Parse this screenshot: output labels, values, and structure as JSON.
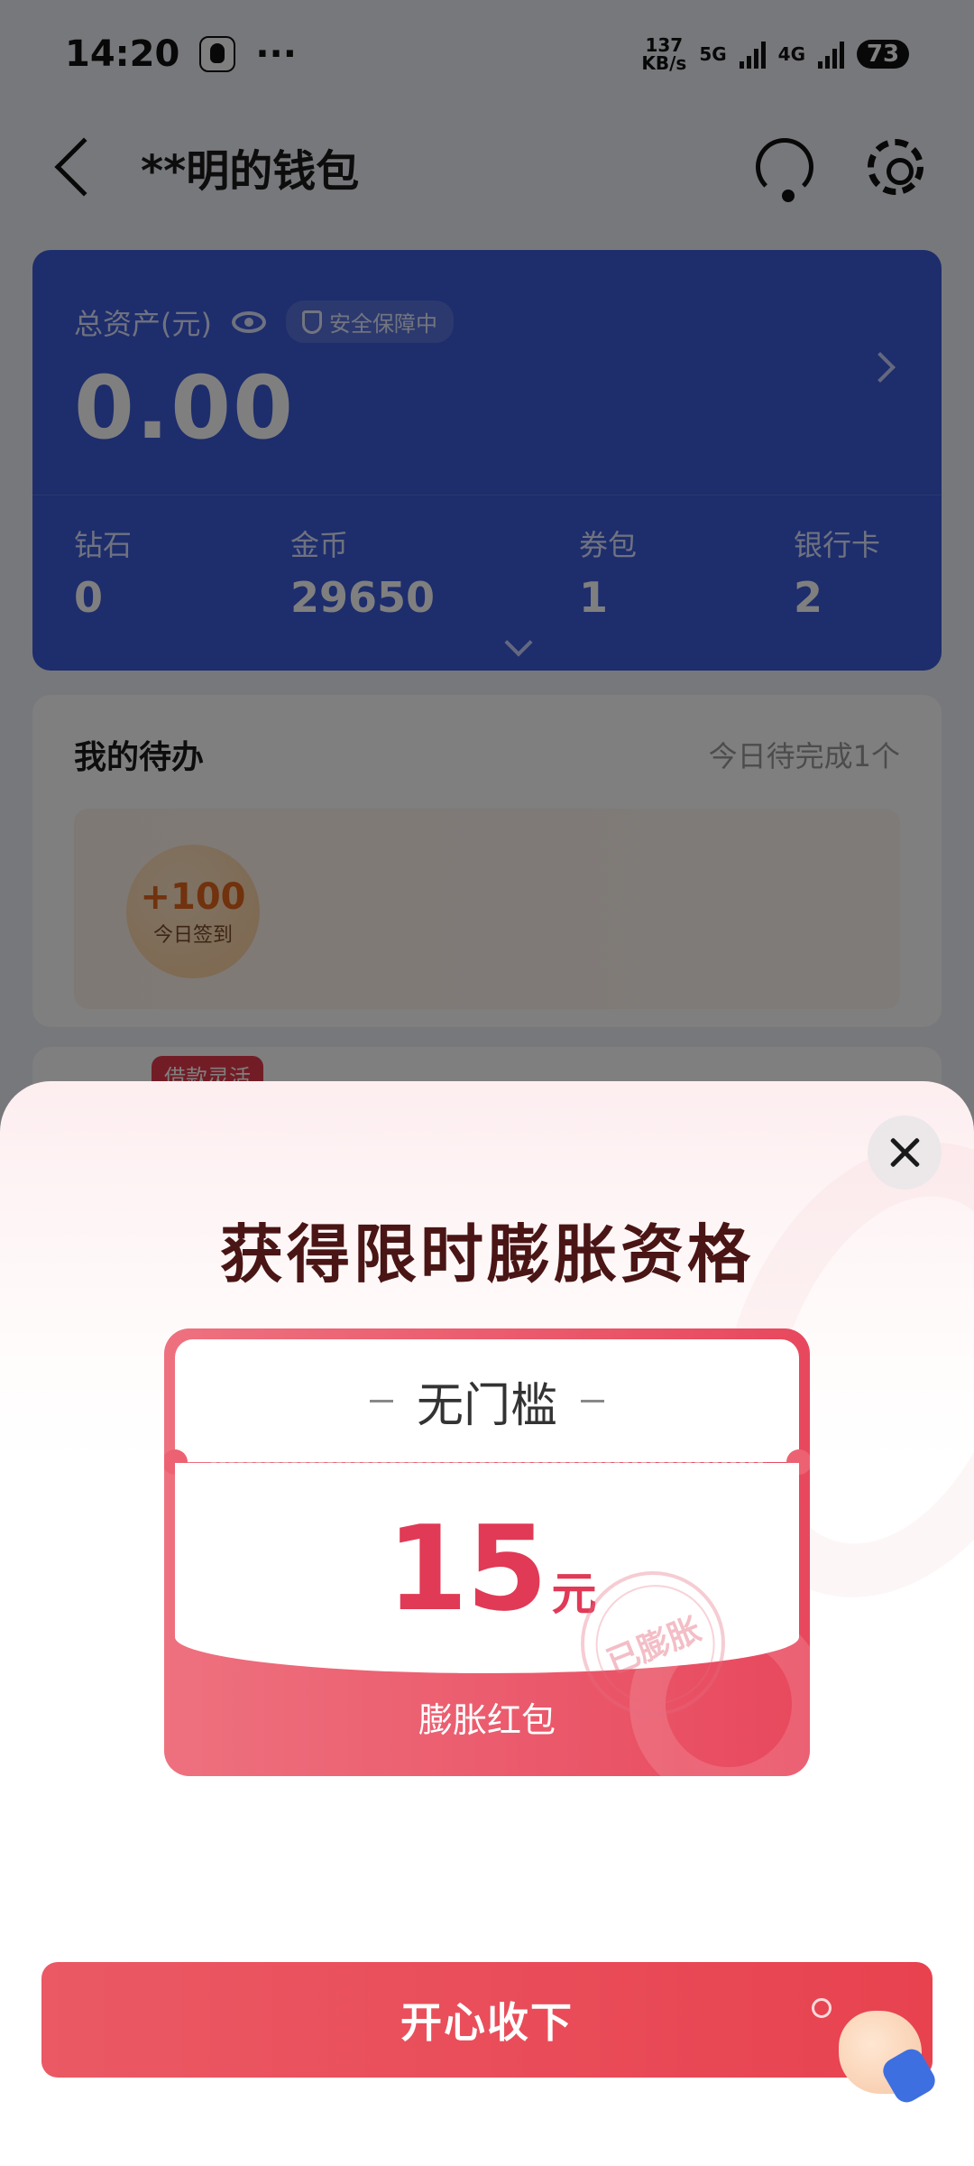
{
  "status_bar": {
    "time": "14:20",
    "more": "···",
    "net_speed_value": "137",
    "net_speed_unit": "KB/s",
    "sim1": "5G",
    "sim2": "4G",
    "battery": "73"
  },
  "nav": {
    "title": "**明的钱包"
  },
  "assets": {
    "label": "总资产(元)",
    "safety_badge": "安全保障中",
    "total": "0.00",
    "stats": [
      {
        "label": "钻石",
        "value": "0"
      },
      {
        "label": "金币",
        "value": "29650"
      },
      {
        "label": "券包",
        "value": "1"
      },
      {
        "label": "银行卡",
        "value": "2"
      }
    ]
  },
  "todo": {
    "title": "我的待办",
    "subtitle": "今日待完成1个",
    "checkin_points": "+100",
    "checkin_label": "今日签到"
  },
  "loan": {
    "tag": "借款灵活"
  },
  "popup": {
    "title": "获得限时膨胀资格",
    "threshold": "无门槛",
    "amount": "15",
    "unit": "元",
    "stamp": "已膨胀",
    "envelope_label": "膨胀红包",
    "accept_button": "开心收下"
  },
  "colors": {
    "asset_card": "#3d5bd8",
    "accent_red": "#e8424f",
    "amount_red": "#e03a56",
    "title_dark": "#4a1515"
  }
}
